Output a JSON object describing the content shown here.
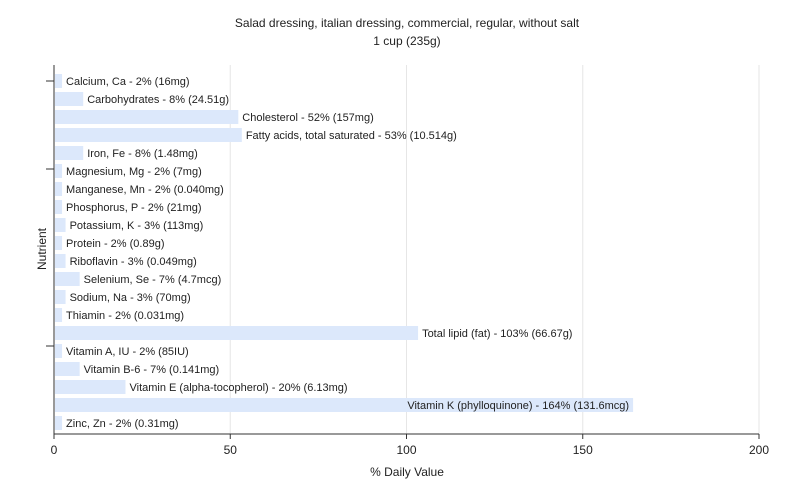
{
  "chart_data": {
    "type": "bar",
    "orientation": "horizontal",
    "title": "Salad dressing, italian dressing, commercial, regular, without salt",
    "subtitle": "1 cup (235g)",
    "xlabel": "% Daily Value",
    "ylabel": "Nutrient",
    "xlim": [
      0,
      200
    ],
    "xticks": [
      0,
      50,
      100,
      150,
      200
    ],
    "grid": true,
    "bar_color": "#dce8fb",
    "categories": [
      "Calcium, Ca",
      "Carbohydrates",
      "Cholesterol",
      "Fatty acids, total saturated",
      "Iron, Fe",
      "Magnesium, Mg",
      "Manganese, Mn",
      "Phosphorus, P",
      "Potassium, K",
      "Protein",
      "Riboflavin",
      "Selenium, Se",
      "Sodium, Na",
      "Thiamin",
      "Total lipid (fat)",
      "Vitamin A, IU",
      "Vitamin B-6",
      "Vitamin E (alpha-tocopherol)",
      "Vitamin K (phylloquinone)",
      "Zinc, Zn"
    ],
    "values": [
      2,
      8,
      52,
      53,
      8,
      2,
      2,
      2,
      3,
      2,
      3,
      7,
      3,
      2,
      103,
      2,
      7,
      20,
      164,
      2
    ],
    "labels": [
      "Calcium, Ca - 2% (16mg)",
      "Carbohydrates - 8% (24.51g)",
      "Cholesterol - 52% (157mg)",
      "Fatty acids, total saturated - 53% (10.514g)",
      "Iron, Fe - 8% (1.48mg)",
      "Magnesium, Mg - 2% (7mg)",
      "Manganese, Mn - 2% (0.040mg)",
      "Phosphorus, P - 2% (21mg)",
      "Potassium, K - 3% (113mg)",
      "Protein - 2% (0.89g)",
      "Riboflavin - 3% (0.049mg)",
      "Selenium, Se - 7% (4.7mcg)",
      "Sodium, Na - 3% (70mg)",
      "Thiamin - 2% (0.031mg)",
      "Total lipid (fat) - 103% (66.67g)",
      "Vitamin A, IU - 2% (85IU)",
      "Vitamin B-6 - 7% (0.141mg)",
      "Vitamin E (alpha-tocopherol) - 20% (6.13mg)",
      "Vitamin K (phylloquinone) - 164% (131.6mcg)",
      "Zinc, Zn - 2% (0.31mg)"
    ]
  }
}
